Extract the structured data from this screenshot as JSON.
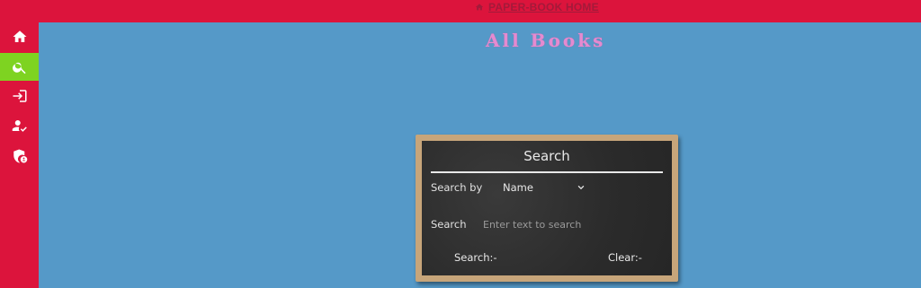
{
  "topbar": {
    "title": "PAPER-BOOK HOME",
    "icon": "home-icon"
  },
  "sidebar": {
    "items": [
      {
        "name": "home",
        "icon": "home-icon",
        "active": false
      },
      {
        "name": "search",
        "icon": "search-icon",
        "active": true
      },
      {
        "name": "login",
        "icon": "login-icon",
        "active": false
      },
      {
        "name": "user-verify",
        "icon": "user-check-icon",
        "active": false
      },
      {
        "name": "admin",
        "icon": "shield-lock-icon",
        "active": false
      }
    ]
  },
  "main": {
    "title": "All Books"
  },
  "search_panel": {
    "title": "Search",
    "search_by_label": "Search by",
    "search_by_value": "Name",
    "search_label": "Search",
    "search_placeholder": "Enter text to search",
    "search_button": "Search:-",
    "clear_button": "Clear:-"
  },
  "colors": {
    "accent_red": "#dc143c",
    "active_green": "#7ed321",
    "background_blue": "#5599c8",
    "title_pink": "#e58ad0",
    "chalkboard": "#2f2f2f",
    "frame": "#c7a57a"
  }
}
